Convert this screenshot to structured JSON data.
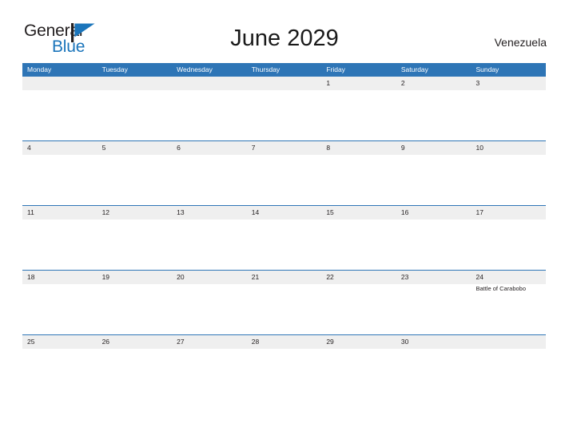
{
  "brand": {
    "name_part1": "General",
    "name_part2": "Blue",
    "flag_icon": "blue-triangle-flag-icon",
    "accent_color": "#1b75bb"
  },
  "header": {
    "title": "June 2029",
    "country": "Venezuela"
  },
  "colors": {
    "header_blue": "#2e75b6",
    "date_band_gray": "#efefef",
    "text_dark": "#231f20",
    "logo_blue": "#1b75bb"
  },
  "calendar": {
    "month": "June",
    "year": "2029",
    "weekdays": [
      "Monday",
      "Tuesday",
      "Wednesday",
      "Thursday",
      "Friday",
      "Saturday",
      "Sunday"
    ],
    "weeks": [
      [
        {
          "day": ""
        },
        {
          "day": ""
        },
        {
          "day": ""
        },
        {
          "day": ""
        },
        {
          "day": "1"
        },
        {
          "day": "2"
        },
        {
          "day": "3"
        }
      ],
      [
        {
          "day": "4"
        },
        {
          "day": "5"
        },
        {
          "day": "6"
        },
        {
          "day": "7"
        },
        {
          "day": "8"
        },
        {
          "day": "9"
        },
        {
          "day": "10"
        }
      ],
      [
        {
          "day": "11"
        },
        {
          "day": "12"
        },
        {
          "day": "13"
        },
        {
          "day": "14"
        },
        {
          "day": "15"
        },
        {
          "day": "16"
        },
        {
          "day": "17"
        }
      ],
      [
        {
          "day": "18"
        },
        {
          "day": "19"
        },
        {
          "day": "20"
        },
        {
          "day": "21"
        },
        {
          "day": "22"
        },
        {
          "day": "23"
        },
        {
          "day": "24",
          "event": "Battle of Carabobo"
        }
      ],
      [
        {
          "day": "25"
        },
        {
          "day": "26"
        },
        {
          "day": "27"
        },
        {
          "day": "28"
        },
        {
          "day": "29"
        },
        {
          "day": "30"
        },
        {
          "day": ""
        }
      ]
    ]
  }
}
